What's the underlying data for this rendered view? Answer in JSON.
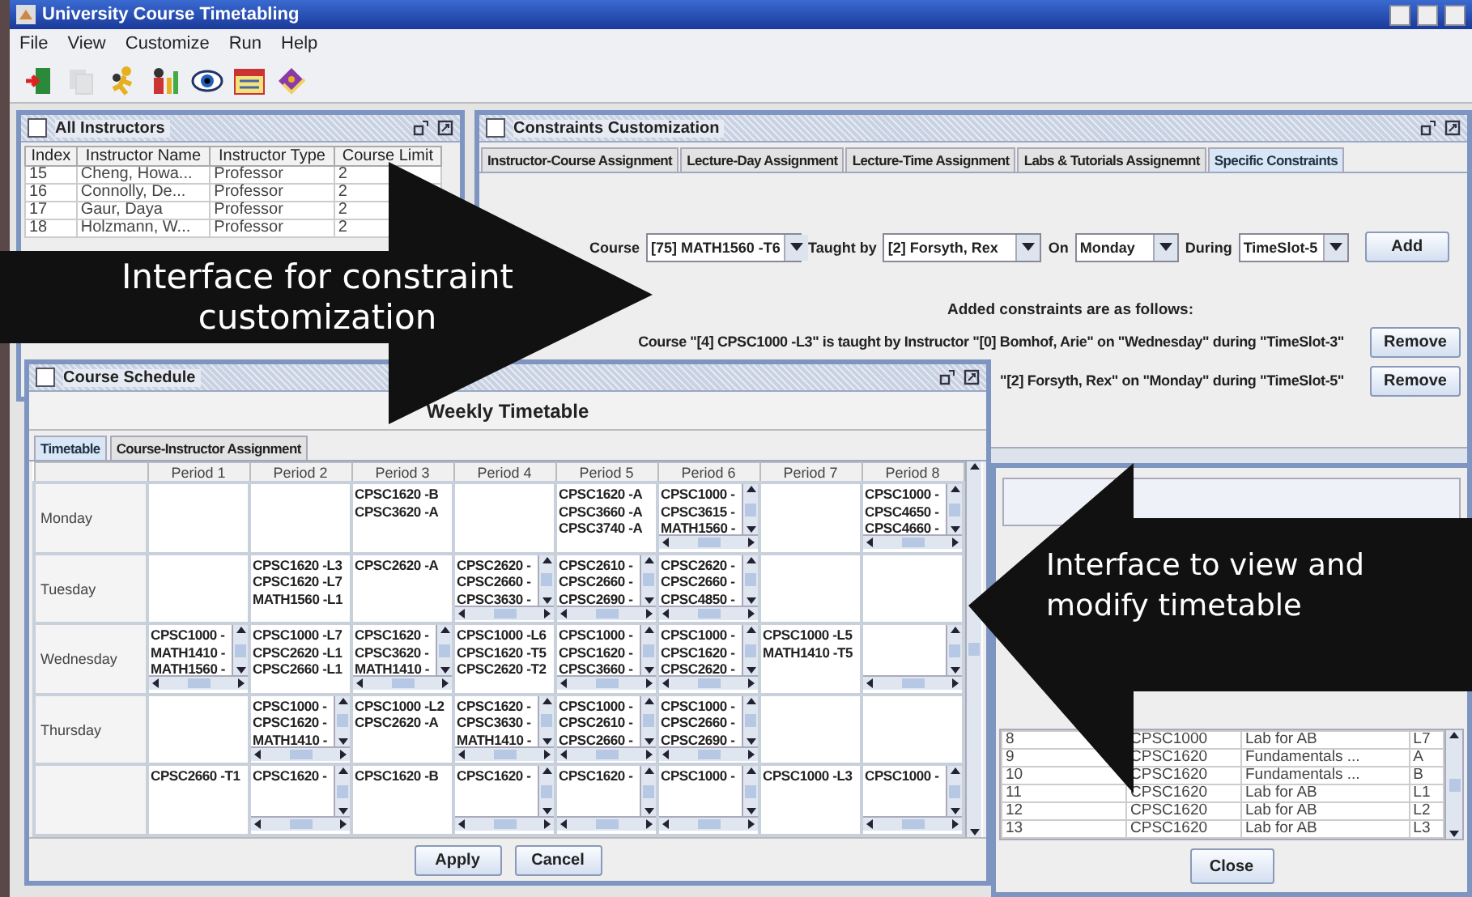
{
  "window": {
    "title": "University Course Timetabling"
  },
  "menu": [
    "File",
    "View",
    "Customize",
    "Run",
    "Help"
  ],
  "toolbar": [
    {
      "kind": "exit",
      "disabled": false
    },
    {
      "kind": "pages",
      "disabled": true
    },
    {
      "kind": "runner",
      "disabled": false
    },
    {
      "kind": "people",
      "disabled": false
    },
    {
      "kind": "eye",
      "disabled": false
    },
    {
      "kind": "calendar",
      "disabled": false
    },
    {
      "kind": "book",
      "disabled": false
    }
  ],
  "instructors_frame": {
    "title": "All Instructors",
    "columns": [
      "Index",
      "Instructor Name",
      "Instructor Type",
      "Course Limit"
    ],
    "rows": [
      [
        "15",
        "Cheng, Howa...",
        "Professor",
        "2"
      ],
      [
        "16",
        "Connolly, De...",
        "Professor",
        "2"
      ],
      [
        "17",
        "Gaur, Daya",
        "Professor",
        "2"
      ],
      [
        "18",
        "Holzmann, W...",
        "Professor",
        "2"
      ]
    ]
  },
  "constraints_frame": {
    "title": "Constraints Customization",
    "tabs": [
      {
        "label": "Instructor-Course Assignment",
        "selected": false
      },
      {
        "label": "Lecture-Day Assignment",
        "selected": false
      },
      {
        "label": "Lecture-Time Assignment",
        "selected": false
      },
      {
        "label": "Labs & Tutorials Assignemnt",
        "selected": false
      },
      {
        "label": "Specific Constraints",
        "selected": true
      }
    ],
    "course_label": "Course",
    "course": "[75] MATH1560 -T6",
    "taught_label": "Taught by",
    "instructor": "[2] Forsyth, Rex",
    "day_label": "On",
    "day": "Monday",
    "during_label": "During",
    "timeslot": "TimeSlot-5",
    "add_button": "Add",
    "list_heading": "Added constraints are as follows:",
    "constraints": [
      {
        "text": "Course \"[4] CPSC1000 -L3\" is taught by Instructor \"[0] Bomhof, Arie\" on \"Wednesday\" during \"TimeSlot-3\"",
        "button": "Remove"
      },
      {
        "text": "\"[2] Forsyth, Rex\" on \"Monday\" during \"TimeSlot-5\"",
        "button": "Remove"
      }
    ]
  },
  "assignment_frame": {
    "rows": [
      [
        "8",
        "CPSC1000",
        "Lab for AB",
        "L7"
      ],
      [
        "9",
        "CPSC1620",
        "Fundamentals ...",
        "A"
      ],
      [
        "10",
        "CPSC1620",
        "Fundamentals ...",
        "B"
      ],
      [
        "11",
        "CPSC1620",
        "Lab for AB",
        "L1"
      ],
      [
        "12",
        "CPSC1620",
        "Lab for AB",
        "L2"
      ],
      [
        "13",
        "CPSC1620",
        "Lab for AB",
        "L3"
      ]
    ],
    "close_button": "Close"
  },
  "schedule_frame": {
    "title": "Course Schedule",
    "heading": "Weekly Timetable",
    "tabs": [
      {
        "label": "Timetable",
        "selected": true
      },
      {
        "label": "Course-Instructor Assignment",
        "selected": false
      }
    ],
    "periods": [
      "Period 1",
      "Period 2",
      "Period 3",
      "Period 4",
      "Period 5",
      "Period 6",
      "Period 7",
      "Period 8"
    ],
    "days": [
      {
        "day": "Monday",
        "cells": [
          {
            "scroll": false
          },
          {
            "scroll": false
          },
          {
            "courses": [
              "CPSC1620 -B",
              "CPSC3620 -A"
            ],
            "scroll": false
          },
          {
            "scroll": false
          },
          {
            "courses": [
              "CPSC1620 -A",
              "CPSC3660 -A",
              "CPSC3740 -A"
            ],
            "scroll": false
          },
          {
            "courses": [
              "CPSC1000 -",
              "CPSC3615 -",
              "MATH1560 -"
            ],
            "scroll": true
          },
          {
            "scroll": false
          },
          {
            "courses": [
              "CPSC1000 -",
              "CPSC4650 -",
              "CPSC4660 -"
            ],
            "scroll": true
          }
        ]
      },
      {
        "day": "Tuesday",
        "cells": [
          {
            "scroll": false
          },
          {
            "courses": [
              "CPSC1620 -L3",
              "CPSC1620 -L7",
              "MATH1560 -L1"
            ],
            "scroll": false
          },
          {
            "courses": [
              "CPSC2620 -A"
            ],
            "scroll": false
          },
          {
            "courses": [
              "CPSC2620 -",
              "CPSC2660 -",
              "CPSC3630 -"
            ],
            "scroll": true
          },
          {
            "courses": [
              "CPSC2610 -",
              "CPSC2660 -",
              "CPSC2690 -"
            ],
            "scroll": true
          },
          {
            "courses": [
              "CPSC2620 -",
              "CPSC2660 -",
              "CPSC4850 -"
            ],
            "scroll": true
          },
          {
            "scroll": false
          },
          {
            "scroll": false
          }
        ]
      },
      {
        "day": "Wednesday",
        "cells": [
          {
            "courses": [
              "CPSC1000 -",
              "MATH1410 -",
              "MATH1560 -"
            ],
            "scroll": true
          },
          {
            "courses": [
              "CPSC1000 -L7",
              "CPSC2620 -L1",
              "CPSC2660 -L1"
            ],
            "scroll": false
          },
          {
            "courses": [
              "CPSC1620 -",
              "CPSC3620 -",
              "MATH1410 -"
            ],
            "scroll": true
          },
          {
            "courses": [
              "CPSC1000 -L6",
              "CPSC1620 -T5",
              "CPSC2620 -T2"
            ],
            "scroll": false
          },
          {
            "courses": [
              "CPSC1000 -",
              "CPSC1620 -",
              "CPSC3660 -"
            ],
            "scroll": true
          },
          {
            "courses": [
              "CPSC1000 -",
              "CPSC1620 -",
              "CPSC2620 -"
            ],
            "scroll": true
          },
          {
            "courses": [
              "CPSC1000 -L5",
              "MATH1410 -T5"
            ],
            "scroll": false
          },
          {
            "scroll": true
          }
        ]
      },
      {
        "day": "Thursday",
        "cells": [
          {
            "scroll": false
          },
          {
            "courses": [
              "CPSC1000 -",
              "CPSC1620 -",
              "MATH1410 -"
            ],
            "scroll": true
          },
          {
            "courses": [
              "CPSC1000 -L2",
              "CPSC2620 -A"
            ],
            "scroll": false
          },
          {
            "courses": [
              "CPSC1620 -",
              "CPSC3630 -",
              "MATH1410 -"
            ],
            "scroll": true
          },
          {
            "courses": [
              "CPSC1000 -",
              "CPSC2610 -",
              "CPSC2660 -"
            ],
            "scroll": true
          },
          {
            "courses": [
              "CPSC1000 -",
              "CPSC2660 -",
              "CPSC2690 -"
            ],
            "scroll": true
          },
          {
            "scroll": false
          },
          {
            "scroll": false
          }
        ]
      },
      {
        "cells": [
          {
            "courses": [
              "CPSC2660 -T1"
            ],
            "scroll": false
          },
          {
            "courses": [
              "CPSC1620 -"
            ],
            "scroll": true
          },
          {
            "courses": [
              "CPSC1620 -B"
            ],
            "scroll": false
          },
          {
            "courses": [
              "CPSC1620 -"
            ],
            "scroll": true
          },
          {
            "courses": [
              "CPSC1620 -"
            ],
            "scroll": true
          },
          {
            "courses": [
              "CPSC1000 -"
            ],
            "scroll": true
          },
          {
            "courses": [
              "CPSC1000 -L3"
            ],
            "scroll": false
          },
          {
            "courses": [
              "CPSC1000 -"
            ],
            "scroll": true
          }
        ]
      }
    ],
    "buttons": [
      "Apply",
      "Cancel"
    ]
  },
  "callouts": [
    {
      "text": "Interface for constraint customization"
    },
    {
      "text": "Interface to view and modify timetable"
    }
  ]
}
